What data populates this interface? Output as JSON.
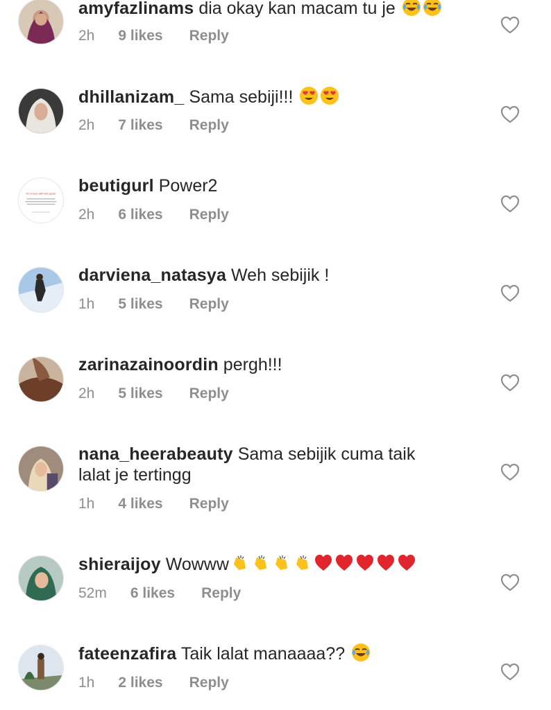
{
  "comments": [
    {
      "username": "amyfazlinams",
      "text": "dia okay kan macam tu je",
      "emojis": [
        "laugh",
        "laugh"
      ],
      "time": "2h",
      "likes": "9 likes",
      "reply": "Reply"
    },
    {
      "username": "dhillanizam_",
      "text": "Sama sebiji!!!",
      "emojis": [
        "heart-eyes",
        "heart-eyes"
      ],
      "time": "2h",
      "likes": "7 likes",
      "reply": "Reply"
    },
    {
      "username": "beutigurl",
      "text": "Power2",
      "emojis": [],
      "time": "2h",
      "likes": "6 likes",
      "reply": "Reply",
      "avatar_text": "I'm in love with this quote"
    },
    {
      "username": "darviena_natasya",
      "text": "Weh sebijik !",
      "emojis": [],
      "time": "1h",
      "likes": "5 likes",
      "reply": "Reply"
    },
    {
      "username": "zarinazainoordin",
      "text": "pergh!!!",
      "emojis": [],
      "time": "2h",
      "likes": "5 likes",
      "reply": "Reply"
    },
    {
      "username": "nana_heerabeauty",
      "text": "Sama sebijik cuma taik lalat je tertingg",
      "emojis": [],
      "time": "1h",
      "likes": "4 likes",
      "reply": "Reply"
    },
    {
      "username": "shieraijoy",
      "text": "Wowww",
      "emojis": [
        "clap",
        "clap",
        "clap",
        "clap",
        "red-heart",
        "red-heart",
        "red-heart",
        "red-heart",
        "red-heart"
      ],
      "time": "52m",
      "likes": "6 likes",
      "reply": "Reply"
    },
    {
      "username": "fateenzafira",
      "text": "Taik lalat manaaaa??",
      "emojis": [
        "laugh"
      ],
      "time": "1h",
      "likes": "2 likes",
      "reply": "Reply"
    }
  ],
  "icons": {
    "like": "heart-outline-icon"
  },
  "colors": {
    "text": "#262626",
    "meta": "#8e8e8e",
    "heart_outline": "#8e8e8e"
  }
}
